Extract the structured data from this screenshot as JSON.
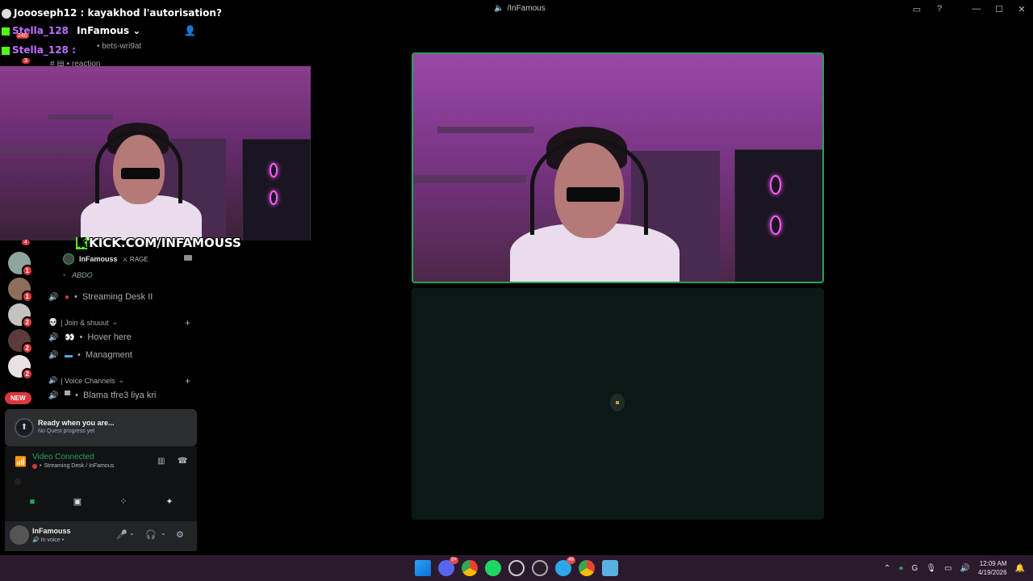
{
  "window": {
    "title": "/InFamous"
  },
  "chat": [
    {
      "user": "Joooseph12",
      "message": "kayakhod l'autorisation?"
    },
    {
      "user": "Stella_128",
      "message": ""
    },
    {
      "user": "Stella_128",
      "message": ""
    }
  ],
  "server": {
    "name": "InFamous",
    "top_channels": [
      "bets-wri9at",
      "reaction"
    ]
  },
  "server_badges": [
    "240",
    "3",
    "4",
    "1",
    "1",
    "1",
    "2",
    "2"
  ],
  "new_badge": "NEW",
  "stream_banner": "KICK.COM/INFAMOUSS",
  "voice_users": [
    {
      "name": "InFamouss",
      "tag": "RAGE"
    },
    {
      "name": "ABDO"
    }
  ],
  "channels": [
    {
      "label": "Streaming Desk II"
    },
    {
      "label": "Hover here"
    },
    {
      "label": "Managment"
    },
    {
      "label": "Blama tfre3 liya kri"
    }
  ],
  "categories": [
    "| Join & shuuut",
    "| Voice Channels"
  ],
  "quest": {
    "title": "Ready when you are...",
    "subtitle": "No Quest progress yet"
  },
  "voice_panel": {
    "status": "Video Connected",
    "location": "Streaming Desk / InFamous"
  },
  "user_panel": {
    "name": "InFamouss",
    "status": "In voice"
  },
  "taskbar": {
    "badges": [
      "9+",
      "48"
    ],
    "time": "12:09 AM",
    "date": "4/19/2026"
  },
  "colors": {
    "connected_green": "#23a55a",
    "badge_red": "#da373c",
    "kick_green": "#53fc18"
  }
}
